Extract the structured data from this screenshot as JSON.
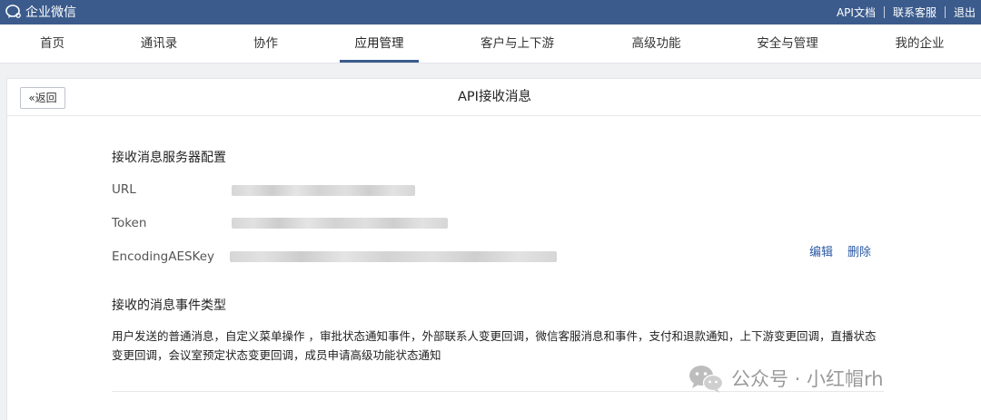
{
  "topbar": {
    "brand": "企业微信",
    "links": [
      "API文档",
      "联系客服",
      "退出"
    ]
  },
  "nav": {
    "items": [
      "首页",
      "通讯录",
      "协作",
      "应用管理",
      "客户与上下游",
      "高级功能",
      "安全与管理",
      "我的企业"
    ],
    "active": "应用管理"
  },
  "page": {
    "back_label": "返回",
    "title": "API接收消息"
  },
  "server_config": {
    "title": "接收消息服务器配置",
    "fields": [
      {
        "label": "URL"
      },
      {
        "label": "Token"
      },
      {
        "label": "EncodingAESKey"
      }
    ],
    "actions": {
      "edit": "编辑",
      "delete": "删除"
    }
  },
  "event_types": {
    "title": "接收的消息事件类型",
    "description": "用户发送的普通消息，自定义菜单操作 ，审批状态通知事件，外部联系人变更回调，微信客服消息和事件，支付和退款通知，上下游变更回调，直播状态变更回调，会议室预定状态变更回调，成员申请高级功能状态通知"
  },
  "watermark": {
    "text": "公众号 · 小红帽rh"
  },
  "colors": {
    "topbar": "#3b5b8c",
    "link": "#2b5aa4",
    "background": "#f0f1f3"
  }
}
